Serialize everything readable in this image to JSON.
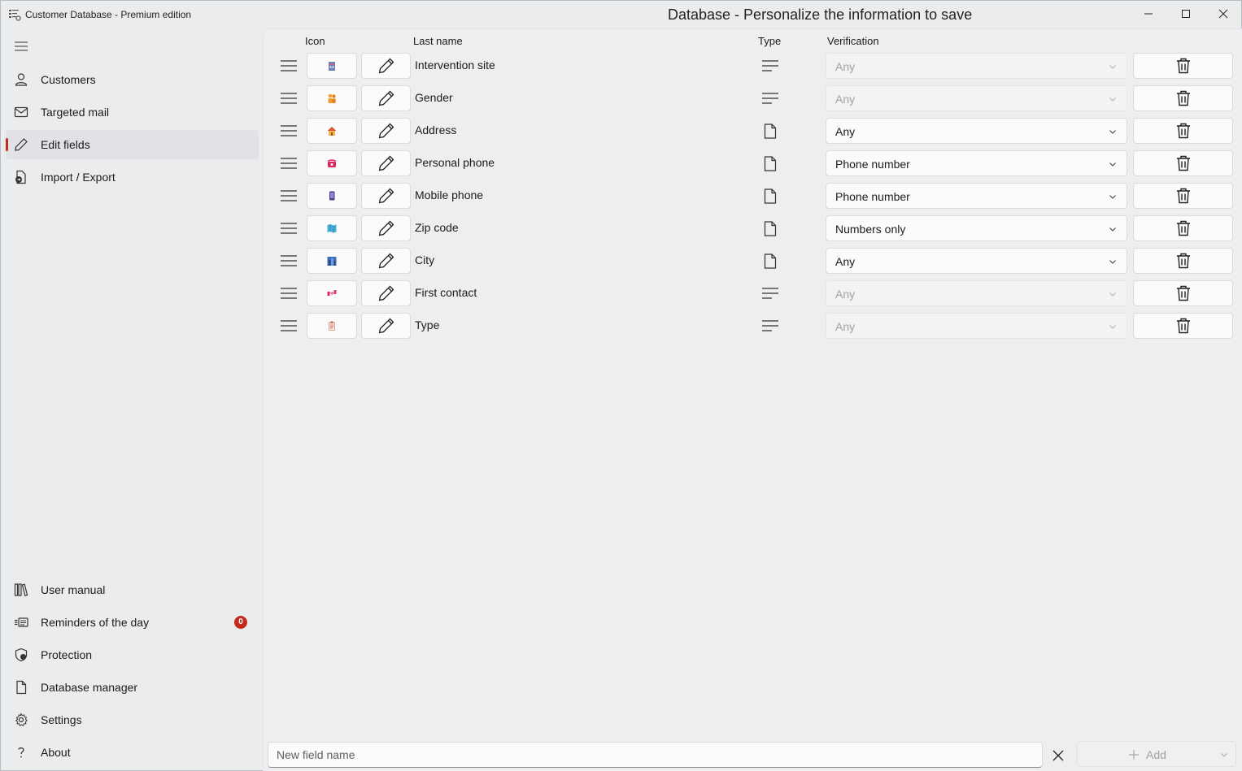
{
  "window": {
    "app_title": "Customer Database - Premium edition",
    "page_title": "Database - Personalize the information to save"
  },
  "sidebar": {
    "top_items": [
      {
        "label": "Customers",
        "icon": "person-icon"
      },
      {
        "label": "Targeted mail",
        "icon": "mail-icon"
      },
      {
        "label": "Edit fields",
        "icon": "pencil-icon",
        "active": true
      },
      {
        "label": "Import / Export",
        "icon": "import-export-icon"
      }
    ],
    "bottom_items": [
      {
        "label": "User manual",
        "icon": "library-icon"
      },
      {
        "label": "Reminders of the day",
        "icon": "reminders-icon",
        "badge": "0"
      },
      {
        "label": "Protection",
        "icon": "shield-icon"
      },
      {
        "label": "Database manager",
        "icon": "document-icon"
      },
      {
        "label": "Settings",
        "icon": "gear-icon"
      },
      {
        "label": "About",
        "icon": "question-icon"
      }
    ]
  },
  "table": {
    "columns": {
      "icon": "Icon",
      "name": "Last name",
      "type": "Type",
      "verification": "Verification"
    },
    "rows": [
      {
        "name": "Intervention site",
        "field_icon": "building-icon",
        "type": "text-lines-icon",
        "verification": "Any",
        "enabled": false
      },
      {
        "name": "Gender",
        "field_icon": "people-icon",
        "type": "text-lines-icon",
        "verification": "Any",
        "enabled": false
      },
      {
        "name": "Address",
        "field_icon": "house-icon",
        "type": "file-icon",
        "verification": "Any",
        "enabled": true
      },
      {
        "name": "Personal phone",
        "field_icon": "telephone-icon",
        "type": "file-icon",
        "verification": "Phone number",
        "enabled": true
      },
      {
        "name": "Mobile phone",
        "field_icon": "mobile-phone-icon",
        "type": "file-icon",
        "verification": "Phone number",
        "enabled": true
      },
      {
        "name": "Zip code",
        "field_icon": "map-icon",
        "type": "file-icon",
        "verification": "Numbers only",
        "enabled": true
      },
      {
        "name": "City",
        "field_icon": "cityscape-icon",
        "type": "file-icon",
        "verification": "Any",
        "enabled": true
      },
      {
        "name": "First contact",
        "field_icon": "handshake-icon",
        "type": "text-lines-icon",
        "verification": "Any",
        "enabled": false
      },
      {
        "name": "Type",
        "field_icon": "clipboard-icon",
        "type": "text-lines-icon",
        "verification": "Any",
        "enabled": false
      }
    ]
  },
  "bottom_bar": {
    "new_field_placeholder": "New field name",
    "add_label": "Add"
  },
  "colors": {
    "accent": "#c42b1c",
    "sidebar_bg": "#ebecee",
    "panel_bg": "#eeeef0"
  }
}
